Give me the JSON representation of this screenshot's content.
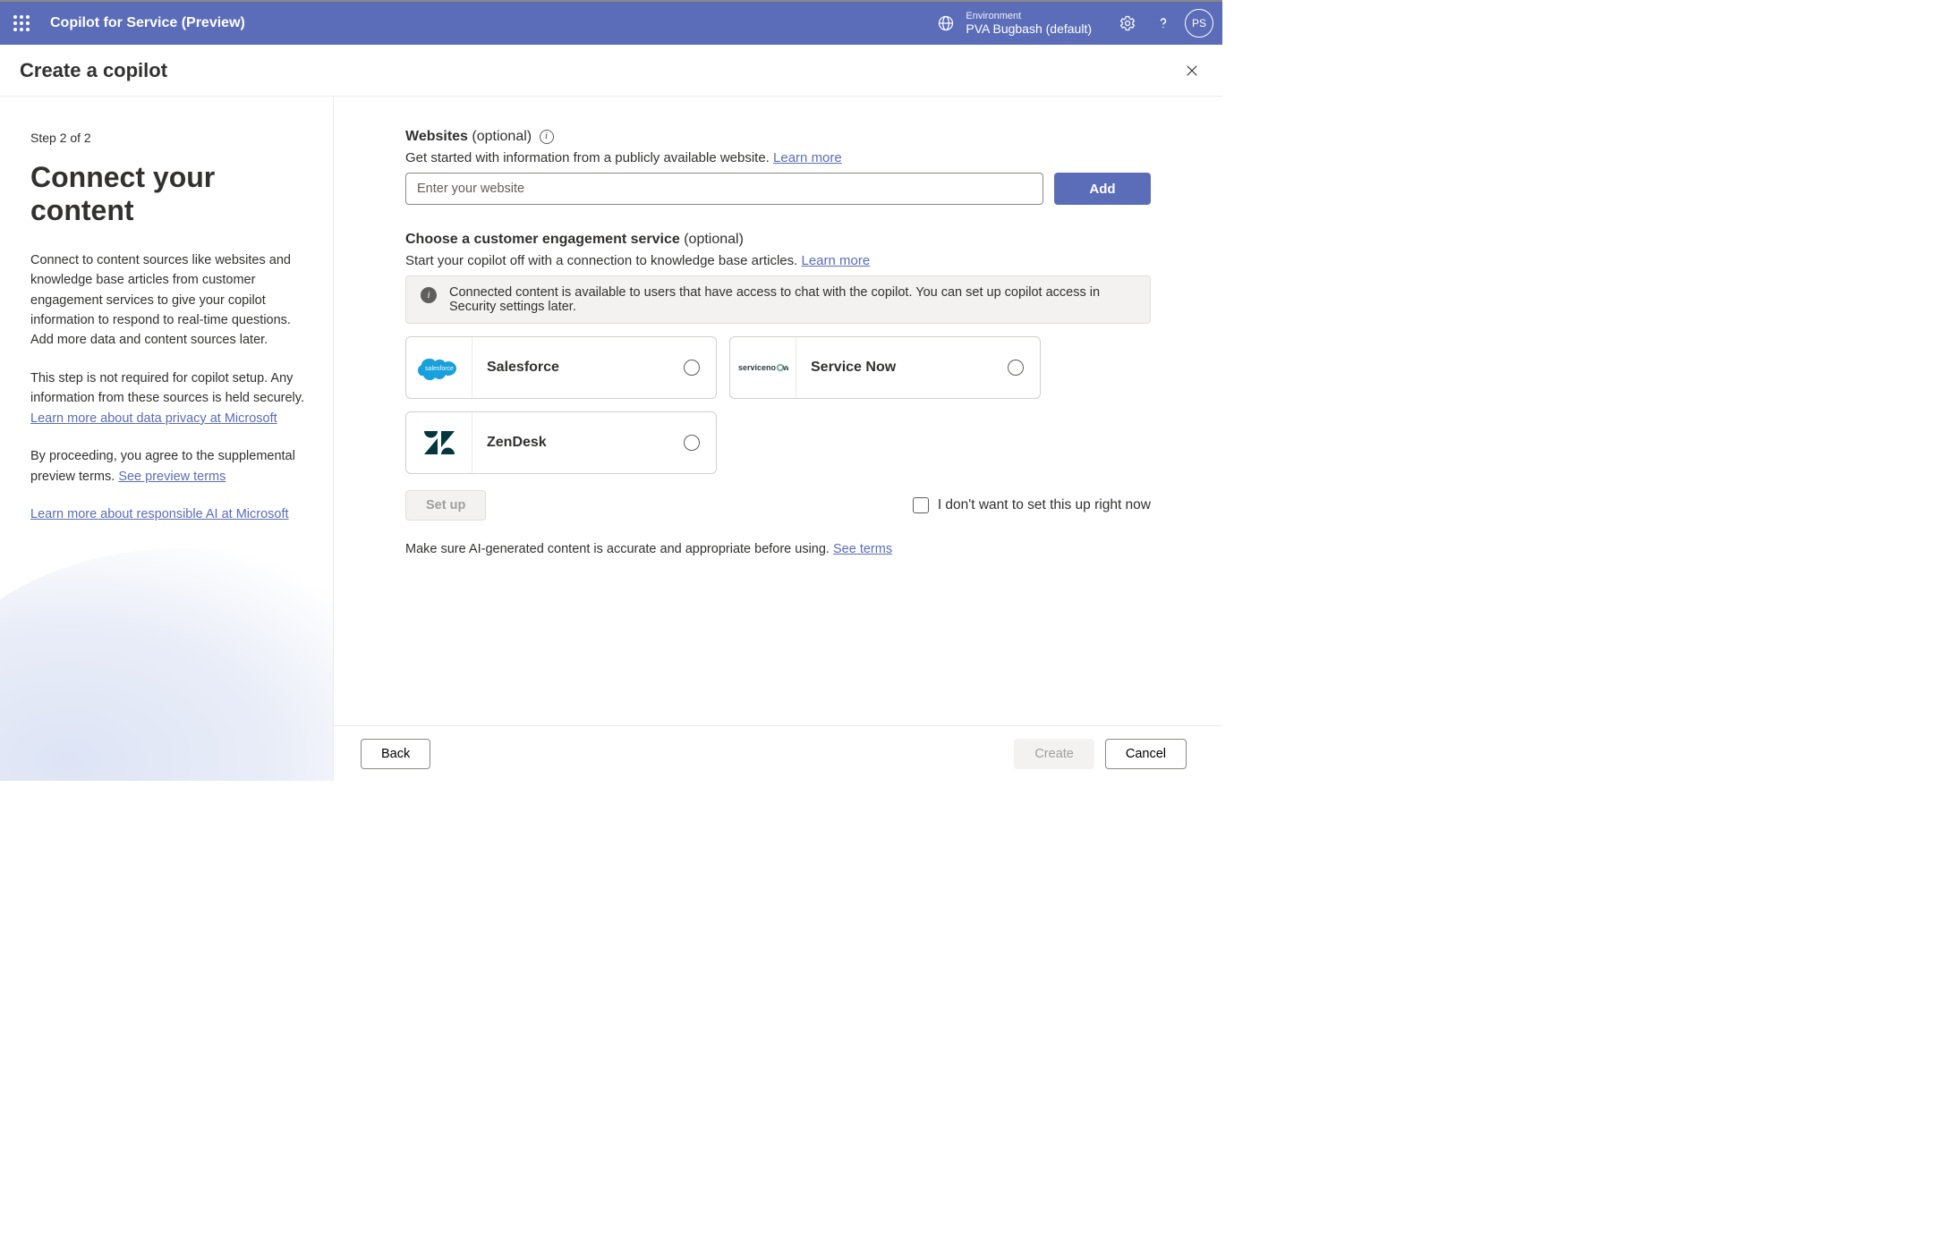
{
  "topbar": {
    "app_title": "Copilot for Service (Preview)",
    "env_label": "Environment",
    "env_name": "PVA Bugbash (default)",
    "avatar_initials": "PS"
  },
  "header": {
    "title": "Create a copilot"
  },
  "left": {
    "step": "Step 2 of 2",
    "heading": "Connect your content",
    "p1": "Connect to content sources like websites and knowledge base articles from customer engagement services to give your copilot information to respond to real-time questions. Add more data and content sources later.",
    "p2a": "This step is not required for copilot setup. Any information from these sources is held securely. ",
    "p2_link": "Learn more about data privacy at Microsoft",
    "p3a": "By proceeding, you agree to the supplemental preview terms. ",
    "p3_link": "See preview terms",
    "p4_link": "Learn more about responsible AI at Microsoft"
  },
  "right": {
    "websites": {
      "label_strong": "Websites",
      "label_optional": " (optional)",
      "sub_pre": "Get started with information from a publicly available website. ",
      "sub_link": "Learn more",
      "placeholder": "Enter your website",
      "add": "Add"
    },
    "ces": {
      "label_strong": "Choose a customer engagement service",
      "label_optional": " (optional)",
      "sub_pre": "Start your copilot off with a connection to knowledge base articles. ",
      "sub_link": "Learn more",
      "banner": "Connected content is available to users that have access to chat with the copilot. You can set up copilot access in Security settings later.",
      "services": [
        {
          "name": "Salesforce"
        },
        {
          "name": "Service Now"
        },
        {
          "name": "ZenDesk"
        }
      ],
      "setup": "Set up",
      "skip": "I don't want to set this up right now"
    },
    "terms_pre": "Make sure AI-generated content is accurate and appropriate before using. ",
    "terms_link": "See terms"
  },
  "footer": {
    "back": "Back",
    "create": "Create",
    "cancel": "Cancel"
  }
}
